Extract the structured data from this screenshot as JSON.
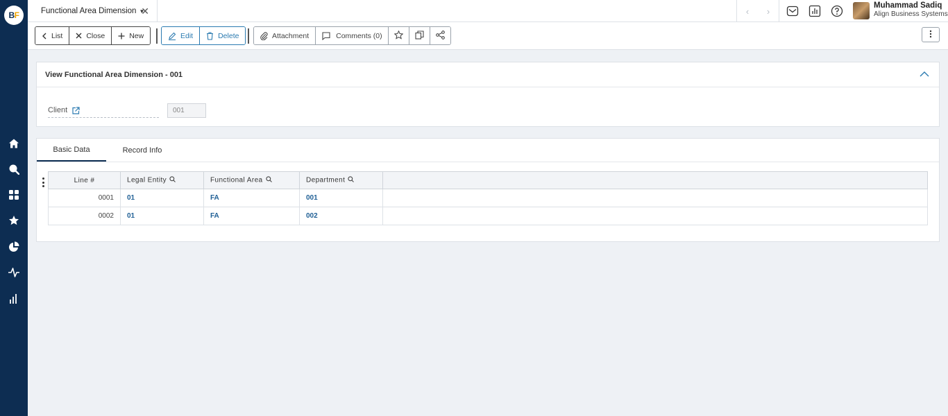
{
  "app": {
    "logo_text_a": "B",
    "logo_text_b": "F"
  },
  "topbar": {
    "tab_title": "Functional Area Dimension",
    "user_name": "Muhammad Sadiq",
    "user_org": "Align Business Systems"
  },
  "toolbar": {
    "list_label": "List",
    "close_label": "Close",
    "new_label": "New",
    "edit_label": "Edit",
    "delete_label": "Delete",
    "attachment_label": "Attachment",
    "comments_label": "Comments (0)"
  },
  "header_panel": {
    "title": "View Functional Area Dimension - 001",
    "client_label": "Client",
    "client_value": "001"
  },
  "detail_panel": {
    "tabs": [
      {
        "label": "Basic Data",
        "active": true
      },
      {
        "label": "Record Info",
        "active": false
      }
    ],
    "columns": [
      "Line #",
      "Legal Entity",
      "Functional Area",
      "Department"
    ],
    "rows": [
      {
        "line": "0001",
        "legal_entity": "01",
        "functional_area": "FA",
        "department": "001"
      },
      {
        "line": "0002",
        "legal_entity": "01",
        "functional_area": "FA",
        "department": "002"
      }
    ]
  },
  "colors": {
    "rail": "#0d2d52",
    "accent": "#2a7ab0",
    "link": "#1f5f95",
    "logo_accent": "#f0a500"
  }
}
